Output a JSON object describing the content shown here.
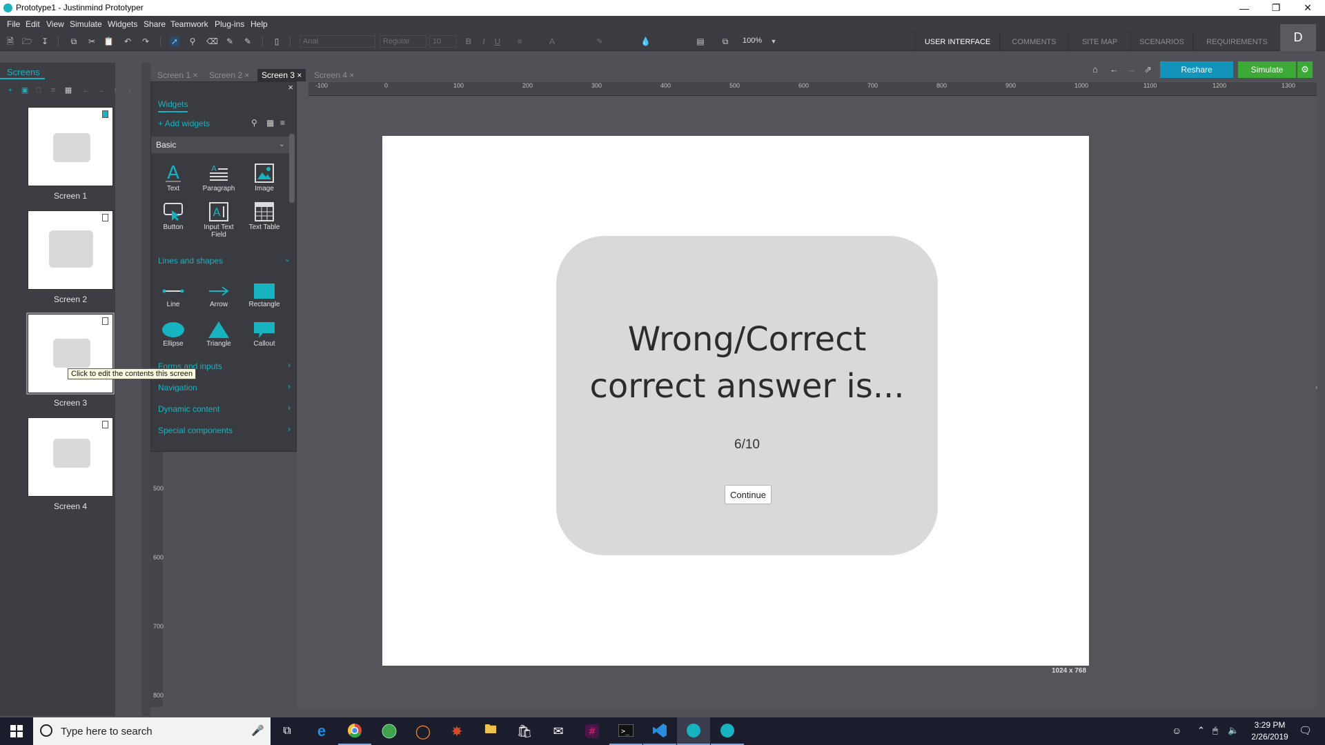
{
  "window": {
    "title": "Prototype1 - Justinmind Prototyper"
  },
  "menu": [
    "File",
    "Edit",
    "View",
    "Simulate",
    "Widgets",
    "Share",
    "Teamwork",
    "Plug-ins",
    "Help"
  ],
  "toolbar": {
    "font": "Arial",
    "weight": "Regular",
    "size": "10",
    "zoom": "100%"
  },
  "view_tabs": [
    "USER INTERFACE",
    "COMMENTS",
    "SITE MAP",
    "SCENARIOS",
    "REQUIREMENTS"
  ],
  "user_initial": "D",
  "screens_panel": {
    "tab_label": "Screens",
    "screens": [
      {
        "label": "Screen 1"
      },
      {
        "label": "Screen 2"
      },
      {
        "label": "Screen 3"
      },
      {
        "label": "Screen 4"
      }
    ],
    "tooltip": "Click to edit the contents this screen"
  },
  "screen_tabs": [
    "Screen 1",
    "Screen 2",
    "Screen 3",
    "Screen 4"
  ],
  "active_screen_tab": "Screen 3",
  "actions": {
    "reshare": "Reshare",
    "simulate": "Simulate"
  },
  "widgets_panel": {
    "tab_label": "Widgets",
    "add_widgets": "Add widgets",
    "basic_label": "Basic",
    "basic": [
      "Text",
      "Paragraph",
      "Image",
      "Button",
      "Input Text Field",
      "Text Table"
    ],
    "lines_label": "Lines and shapes",
    "lines": [
      "Line",
      "Arrow",
      "Rectangle",
      "Ellipse",
      "Triangle",
      "Callout"
    ],
    "sections": [
      "Forms and inputs",
      "Navigation",
      "Dynamic content",
      "Special components"
    ]
  },
  "ruler": {
    "top": [
      "-100",
      "0",
      "100",
      "200",
      "300",
      "400",
      "500",
      "600",
      "700",
      "800",
      "900",
      "1000",
      "1100",
      "1200",
      "1300"
    ],
    "left": [
      "500",
      "600",
      "700",
      "800"
    ]
  },
  "canvas": {
    "heading_line1": "Wrong/Correct",
    "heading_line2": "correct answer is...",
    "score": "6/10",
    "continue_label": "Continue",
    "size_label": "1024 x 768"
  },
  "taskbar": {
    "search_placeholder": "Type here to search",
    "time": "3:29 PM",
    "date": "2/26/2019"
  },
  "colors": {
    "accent": "#17b3c1",
    "reshare": "#1394bb",
    "simulate": "#3ca937",
    "dialog": "#d9d9d9"
  }
}
